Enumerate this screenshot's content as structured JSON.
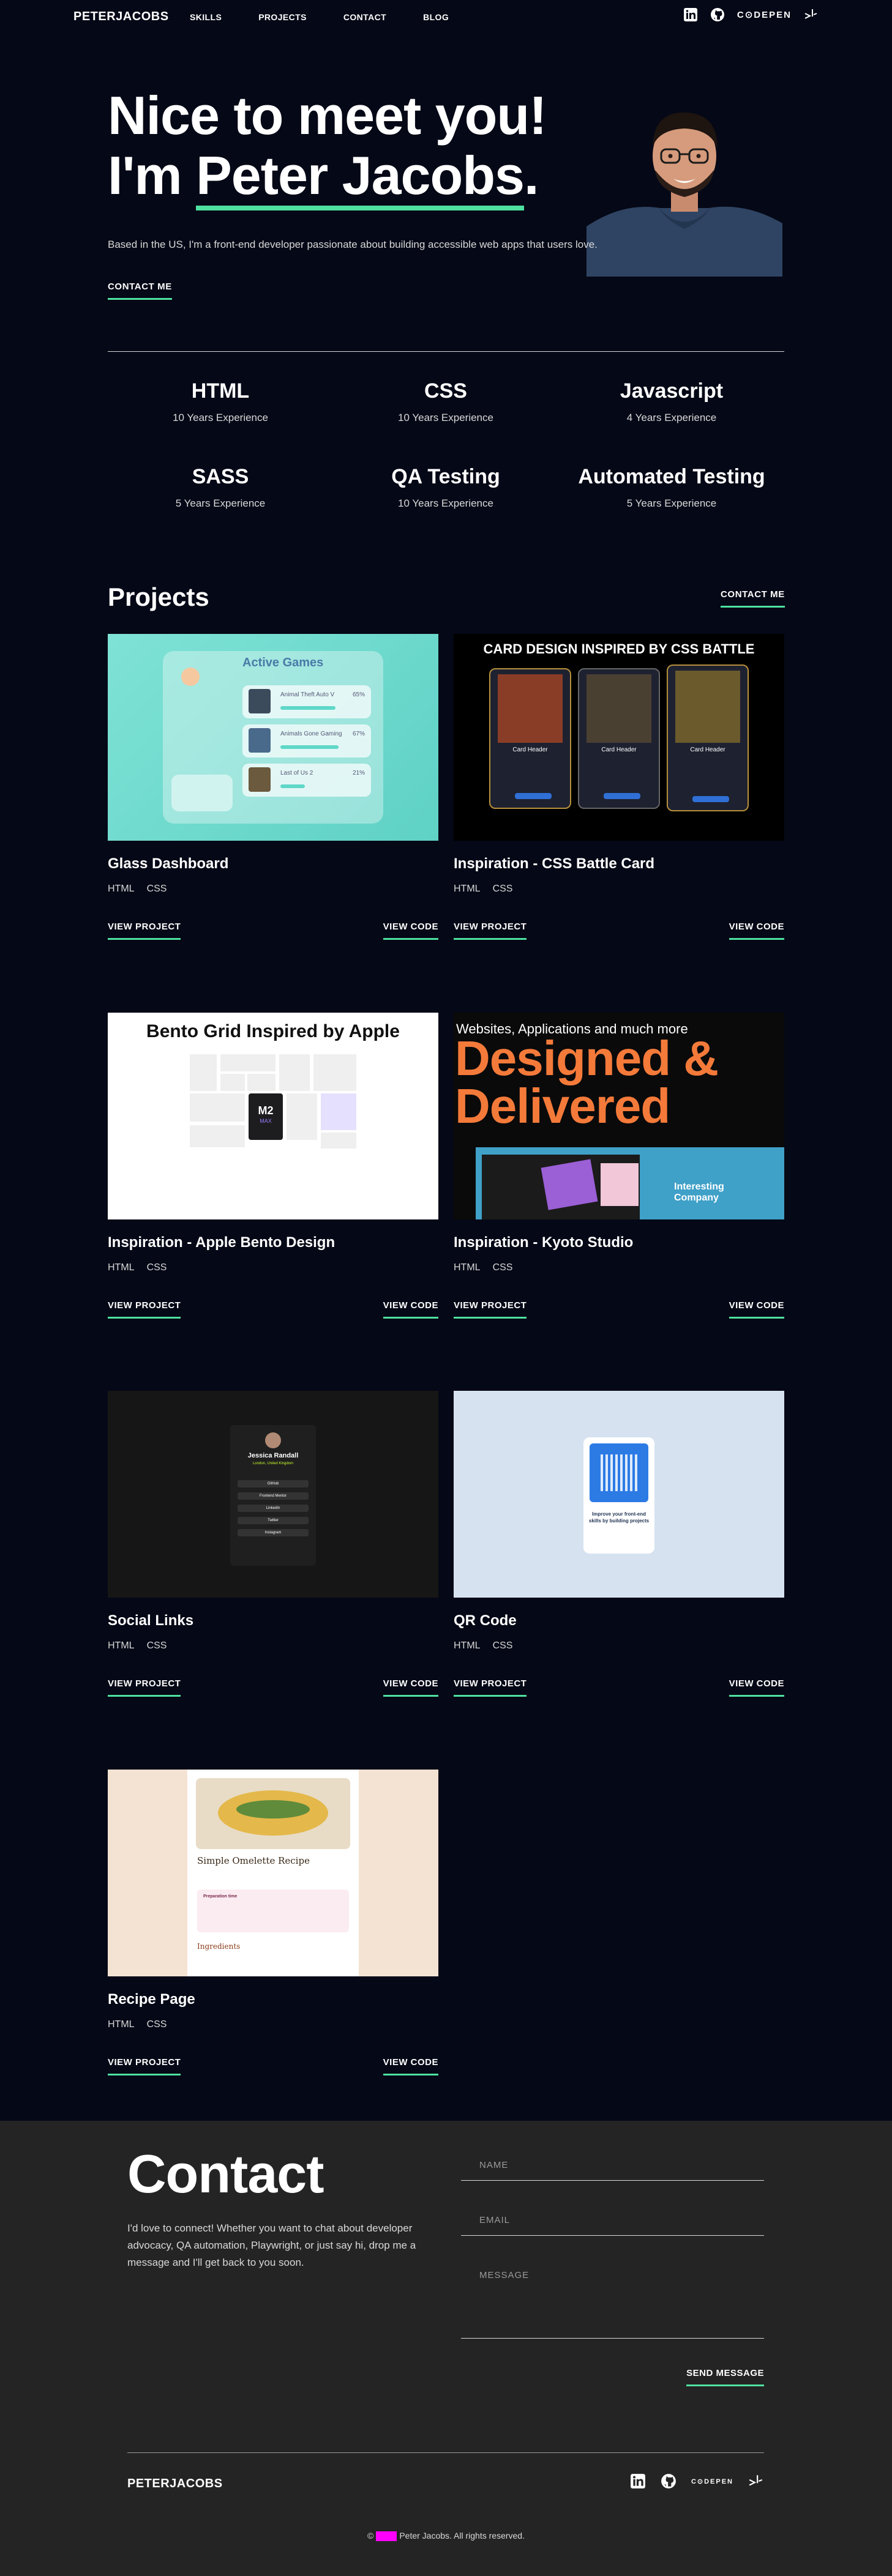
{
  "nav": {
    "logo": "PETERJACOBS",
    "links": [
      "SKILLS",
      "PROJECTS",
      "CONTACT",
      "BLOG"
    ],
    "codepen": "C⊙DEPEN"
  },
  "hero": {
    "line1": "Nice to meet you!",
    "line2_prefix": "I'm ",
    "name": "Peter Jacobs",
    "line2_suffix": ".",
    "bio": "Based in the US, I'm a front-end developer passionate about building accessible web apps that users love.",
    "cta": "CONTACT ME"
  },
  "skills": [
    {
      "name": "HTML",
      "experience": "10 Years Experience"
    },
    {
      "name": "CSS",
      "experience": "10 Years Experience"
    },
    {
      "name": "Javascript",
      "experience": "4 Years Experience"
    },
    {
      "name": "SASS",
      "experience": "5 Years Experience"
    },
    {
      "name": "QA Testing",
      "experience": "10 Years Experience"
    },
    {
      "name": "Automated Testing",
      "experience": "5 Years Experience"
    }
  ],
  "projects": {
    "heading": "Projects",
    "cta": "CONTACT ME",
    "view_project": "VIEW PROJECT",
    "view_code": "VIEW CODE",
    "items": [
      {
        "title": "Glass Dashboard",
        "tags": [
          "HTML",
          "CSS"
        ],
        "thumb": {
          "heading": "Active Games",
          "games": [
            "Animal Theft Auto V",
            "Animals Gone Gaming",
            "Last of Us 2"
          ],
          "percents": [
            "65%",
            "67%",
            "21%"
          ]
        }
      },
      {
        "title": "Inspiration - CSS Battle Card",
        "tags": [
          "HTML",
          "CSS"
        ],
        "thumb": {
          "heading": "CARD DESIGN INSPIRED BY CSS BATTLE",
          "card_label": "Card Header"
        }
      },
      {
        "title": "Inspiration - Apple Bento Design",
        "tags": [
          "HTML",
          "CSS"
        ],
        "thumb": {
          "heading": "Bento Grid Inspired by Apple",
          "chip": "M2",
          "chip_sub": "MAX"
        }
      },
      {
        "title": "Inspiration - Kyoto Studio",
        "tags": [
          "HTML",
          "CSS"
        ],
        "thumb": {
          "small": "Websites, Applications and much more",
          "big1": "Designed &",
          "big2": "Delivered",
          "box1": "Interesting",
          "box2": "Company"
        }
      },
      {
        "title": "Social Links",
        "tags": [
          "HTML",
          "CSS"
        ],
        "thumb": {
          "name": "Jessica Randall",
          "place": "London, United Kingdom",
          "buttons": [
            "GitHub",
            "Frontend Mentor",
            "LinkedIn",
            "Twitter",
            "Instagram"
          ]
        }
      },
      {
        "title": "QR Code",
        "tags": [
          "HTML",
          "CSS"
        ],
        "thumb": {
          "caption": "Improve your front-end skills by building projects"
        }
      },
      {
        "title": "Recipe Page",
        "tags": [
          "HTML",
          "CSS"
        ],
        "thumb": {
          "title": "Simple Omelette Recipe",
          "prep": "Preparation time",
          "ingredients": "Ingredients"
        }
      }
    ]
  },
  "contact": {
    "heading": "Contact",
    "text": "I'd love to connect! Whether you want to chat about developer advocacy, QA automation, Playwright, or just say hi, drop me a message and I'll get back to you soon.",
    "name_placeholder": "NAME",
    "email_placeholder": "EMAIL",
    "message_placeholder": "MESSAGE",
    "send": "SEND MESSAGE"
  },
  "footer": {
    "logo": "PETERJACOBS",
    "codepen": "C⊙DEPEN",
    "copyright_prefix": "©",
    "copyright_suffix": "Peter Jacobs. All rights reserved."
  },
  "colors": {
    "background": "#050816",
    "accent": "#4ee1a0",
    "contact_bg": "#242424"
  }
}
